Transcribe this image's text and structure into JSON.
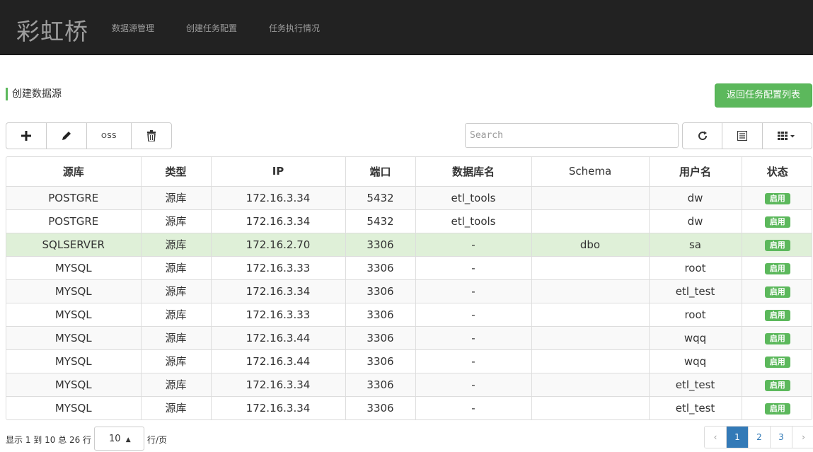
{
  "nav": {
    "brand": "彩虹桥",
    "links": [
      "数据源管理",
      "创建任务配置",
      "任务执行情况"
    ]
  },
  "section_title": "创建数据源",
  "back_button": "返回任务配置列表",
  "toolbar": {
    "add_icon": "plus-icon",
    "edit_icon": "pencil-icon",
    "oss_label": "OSS",
    "delete_icon": "trash-icon",
    "refresh_icon": "refresh-icon",
    "toggle_icon": "list-icon",
    "columns_icon": "columns-grid-icon"
  },
  "search": {
    "placeholder": "Search",
    "value": ""
  },
  "table": {
    "headers": [
      "源库",
      "类型",
      "IP",
      "端口",
      "数据库名",
      "Schema",
      "用户名",
      "状态"
    ],
    "rows": [
      [
        "POSTGRE",
        "源库",
        "172.16.3.34",
        "5432",
        "etl_tools",
        "",
        "dw",
        "启用"
      ],
      [
        "POSTGRE",
        "源库",
        "172.16.3.34",
        "5432",
        "etl_tools",
        "",
        "dw",
        "启用"
      ],
      [
        "SQLSERVER",
        "源库",
        "172.16.2.70",
        "3306",
        "-",
        "dbo",
        "sa",
        "启用"
      ],
      [
        "MYSQL",
        "源库",
        "172.16.3.33",
        "3306",
        "-",
        "",
        "root",
        "启用"
      ],
      [
        "MYSQL",
        "源库",
        "172.16.3.34",
        "3306",
        "-",
        "",
        "etl_test",
        "启用"
      ],
      [
        "MYSQL",
        "源库",
        "172.16.3.33",
        "3306",
        "-",
        "",
        "root",
        "启用"
      ],
      [
        "MYSQL",
        "源库",
        "172.16.3.44",
        "3306",
        "-",
        "",
        "wqq",
        "启用"
      ],
      [
        "MYSQL",
        "源库",
        "172.16.3.44",
        "3306",
        "-",
        "",
        "wqq",
        "启用"
      ],
      [
        "MYSQL",
        "源库",
        "172.16.3.34",
        "3306",
        "-",
        "",
        "etl_test",
        "启用"
      ],
      [
        "MYSQL",
        "源库",
        "172.16.3.34",
        "3306",
        "-",
        "",
        "etl_test",
        "启用"
      ]
    ],
    "selected_row": 2
  },
  "pager": {
    "info": "显示 1 到 10 总 26 行",
    "page_size": "10",
    "per_page": "行/页",
    "prev": "‹",
    "pages": [
      "1",
      "2",
      "3"
    ],
    "active_page": "1",
    "next": "›"
  },
  "colors": {
    "nav_bg": "#222222",
    "accent_green": "#5cb85c",
    "page_active": "#337ab7",
    "selected_row": "#dff0d8"
  }
}
